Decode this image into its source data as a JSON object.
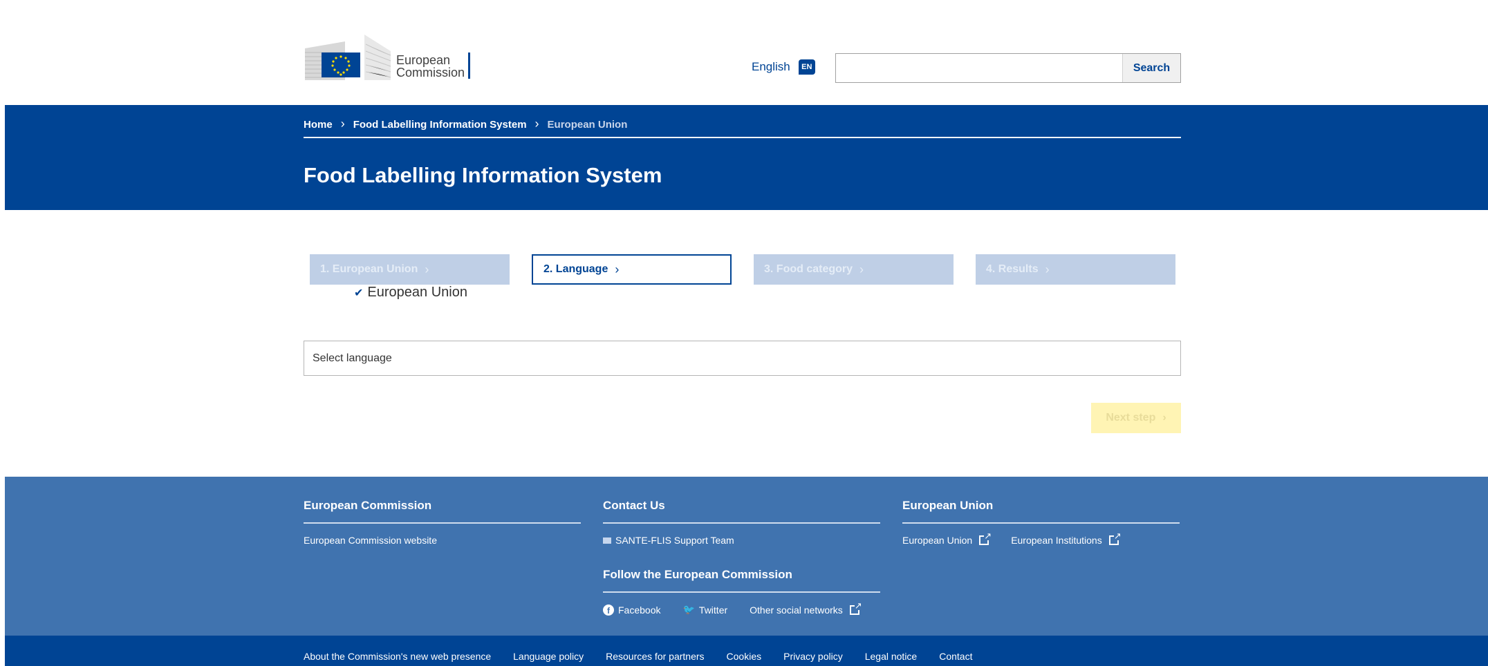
{
  "header": {
    "logo_line1": "European",
    "logo_line2": "Commission",
    "language_label": "English",
    "language_code": "EN",
    "search_placeholder": "",
    "search_button": "Search"
  },
  "breadcrumb": [
    {
      "label": "Home"
    },
    {
      "label": "Food Labelling Information System"
    },
    {
      "label": "European Union"
    }
  ],
  "page_title": "Food Labelling Information System",
  "steps": [
    {
      "label": "1. European Union",
      "state": "disabled"
    },
    {
      "label": "2. Language",
      "state": "active"
    },
    {
      "label": "3. Food category",
      "state": "disabled"
    },
    {
      "label": "4. Results",
      "state": "disabled"
    }
  ],
  "completed_step_value": "European Union",
  "language_select": {
    "placeholder": "Select language"
  },
  "next_button": "Next step",
  "footer": {
    "col1": {
      "title": "European Commission",
      "links": [
        "European Commission website"
      ]
    },
    "col2": {
      "title": "Contact Us",
      "contact": "SANTE-FLIS Support Team",
      "follow_title": "Follow the European Commission",
      "social": [
        "Facebook",
        "Twitter",
        "Other social networks"
      ]
    },
    "col3": {
      "title": "European Union",
      "links": [
        "European Union",
        "European Institutions"
      ]
    },
    "bottom_links": [
      "About the Commission's new web presence",
      "Language policy",
      "Resources for partners",
      "Cookies",
      "Privacy policy",
      "Legal notice",
      "Contact"
    ]
  },
  "colors": {
    "primary": "#004494",
    "footer": "#4073af",
    "step_disabled": "#bfcfe6",
    "next_disabled": "#fff4b4"
  }
}
